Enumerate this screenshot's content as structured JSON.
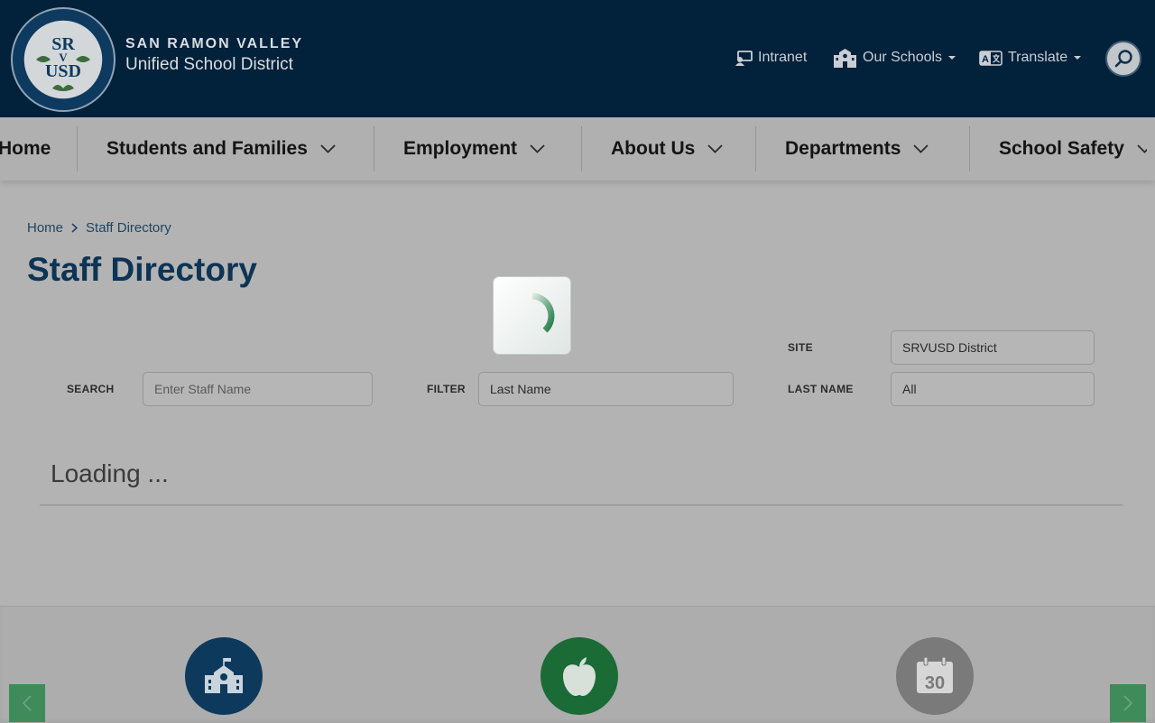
{
  "header": {
    "brand_line1": "SAN RAMON VALLEY",
    "brand_line2": "Unified School District",
    "logo_icon": "district-seal-icon",
    "utility": {
      "intranet": "Intranet",
      "our_schools": "Our Schools",
      "translate": "Translate"
    },
    "search_icon": "search-icon"
  },
  "nav": {
    "items": [
      "Home",
      "Students and Families",
      "Employment",
      "About Us",
      "Departments",
      "School Safety"
    ]
  },
  "breadcrumb": {
    "home": "Home",
    "current": "Staff Directory"
  },
  "page": {
    "title": "Staff Directory"
  },
  "filters": {
    "search_label": "SEARCH",
    "search_placeholder": "Enter Staff Name",
    "filter_label": "FILTER",
    "filter_value": "Last Name",
    "site_label": "SITE",
    "site_value": "SRVUSD District",
    "last_name_label": "LAST NAME",
    "last_name_value": "All"
  },
  "status": {
    "loading": "Loading ..."
  },
  "quick_links": {
    "icons": [
      "school-building-icon",
      "apple-icon",
      "calendar-icon"
    ],
    "calendar_day": "30"
  },
  "colors": {
    "header_bg": "#02213a",
    "title": "#0d3454",
    "spinner_accent": "#1e7d45",
    "school_icon_bg": "#0d3a5c",
    "apple_icon_bg": "#1a6b35",
    "calendar_icon_bg": "#7a7a7a",
    "arrow_bg": "#3f8b5a"
  }
}
